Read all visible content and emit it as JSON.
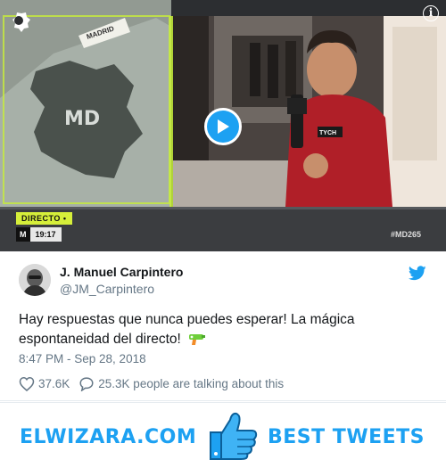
{
  "video": {
    "settings_icon": "gear-icon",
    "info_icon": "info-icon",
    "info_glyph": "i",
    "play_icon": "play-icon",
    "overlay": {
      "badge": "DIRECTO •",
      "logo": "M",
      "time": "19:17",
      "hashtag": "#MD265",
      "sign": "MADRID"
    }
  },
  "tweet": {
    "author_name": "J. Manuel Carpintero",
    "author_handle": "@JM_Carpintero",
    "text": "Hay respuestas que nunca puedes esperar! La mágica espontaneidad del directo!",
    "emoji_icon": "water-pistol-icon",
    "timestamp": "8:47 PM - Sep 28, 2018",
    "likes": "37.6K",
    "talking": "25.3K people are talking about this"
  },
  "banner": {
    "left": "ELWIZARA.COM",
    "right": "BEST TWEETS",
    "icon": "thumbs-up-icon"
  },
  "colors": {
    "twitter_blue": "#1da1f2",
    "text_dark": "#14171a",
    "text_muted": "#657786",
    "badge_green": "#d6ef3a"
  }
}
